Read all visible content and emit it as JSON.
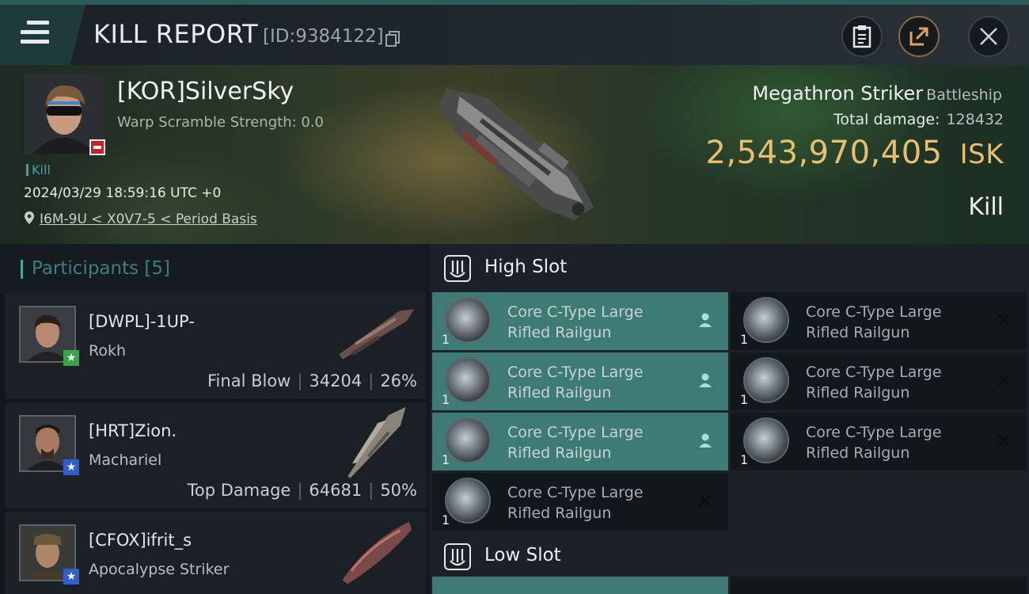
{
  "header": {
    "title": "KILL REPORT",
    "report_id": "[ID:9384122]"
  },
  "victim": {
    "name": "[KOR]SilverSky",
    "warp_scramble": "Warp Scramble Strength: 0.0",
    "tag": "Kill",
    "datetime": "2024/03/29 18:59:16 UTC +0",
    "location": "I6M-9U < X0V7-5 < Period Basis",
    "ship_name": "Megathron Striker",
    "ship_class": "Battleship",
    "total_damage_label": "Total damage:",
    "total_damage": "128432",
    "isk_value": "2,543,970,405",
    "isk_unit": "ISK",
    "result": "Kill"
  },
  "participants": {
    "title": "Participants",
    "count": "[5]",
    "rows": [
      {
        "name": "[DWPL]-1UP-",
        "ship": "Rokh",
        "label": "Final Blow",
        "damage": "34204",
        "percent": "26%",
        "badge_color": "#3aa44a"
      },
      {
        "name": "[HRT]Zion.",
        "ship": "Machariel",
        "label": "Top Damage",
        "damage": "64681",
        "percent": "50%",
        "badge_color": "#2f5fcf"
      },
      {
        "name": "[CFOX]ifrit_s",
        "ship": "Apocalypse Striker",
        "label": "",
        "damage": "",
        "percent": "",
        "badge_color": "#2f5fcf"
      }
    ]
  },
  "slots": {
    "high_title": "High Slot",
    "low_title": "Low Slot",
    "high_items": [
      {
        "line1": "Core C-Type Large",
        "line2": "Rifled Railgun",
        "qty": "1",
        "state": "fitted"
      },
      {
        "line1": "Core C-Type Large",
        "line2": "Rifled Railgun",
        "qty": "1",
        "state": "empty"
      },
      {
        "line1": "Core C-Type Large",
        "line2": "Rifled Railgun",
        "qty": "1",
        "state": "fitted"
      },
      {
        "line1": "Core C-Type Large",
        "line2": "Rifled Railgun",
        "qty": "1",
        "state": "empty"
      },
      {
        "line1": "Core C-Type Large",
        "line2": "Rifled Railgun",
        "qty": "1",
        "state": "fitted"
      },
      {
        "line1": "Core C-Type Large",
        "line2": "Rifled Railgun",
        "qty": "1",
        "state": "empty"
      },
      {
        "line1": "Core C-Type Large",
        "line2": "Rifled Railgun",
        "qty": "1",
        "state": "empty"
      }
    ]
  },
  "colors": {
    "accent": "#47a6a6",
    "isk": "#e9bf6e",
    "fitted": "#3e7b75"
  },
  "icons": [
    "menu-icon",
    "copy-icon",
    "clipboard-icon",
    "share-icon",
    "close-icon",
    "location-pin-icon",
    "person-icon",
    "x-mark-icon",
    "slot-icon"
  ]
}
